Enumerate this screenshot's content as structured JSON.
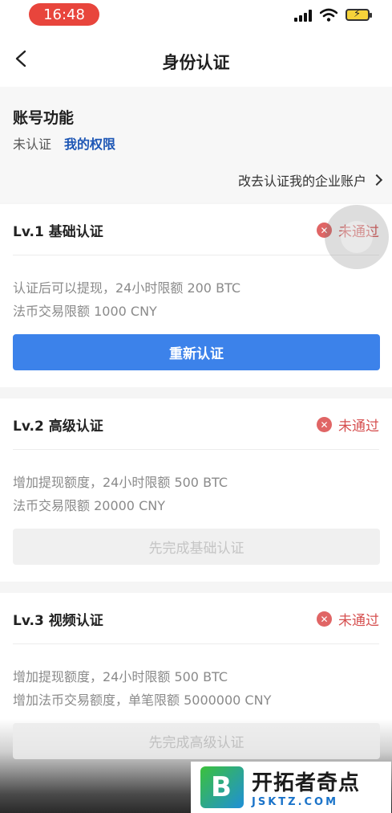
{
  "status_bar": {
    "time": "16:48"
  },
  "nav": {
    "title": "身份认证"
  },
  "account": {
    "title": "账号功能",
    "status": "未认证",
    "permissions_link": "我的权限",
    "enterprise_link": "改去认证我的企业账户"
  },
  "levels": [
    {
      "title": "Lv.1 基础认证",
      "status": "未通过",
      "desc_line1": "认证后可以提现，24小时限额 200 BTC",
      "desc_line2": "法币交易限额 1000 CNY",
      "button": "重新认证"
    },
    {
      "title": "Lv.2 高级认证",
      "status": "未通过",
      "desc_line1": "增加提现额度，24小时限额 500 BTC",
      "desc_line2": "法币交易限额 20000 CNY",
      "button": "先完成基础认证"
    },
    {
      "title": "Lv.3 视频认证",
      "status": "未通过",
      "desc_line1": "增加提现额度，24小时限额 500 BTC",
      "desc_line2": "增加法币交易额度，单笔限额 5000000 CNY",
      "button": "先完成高级认证"
    }
  ],
  "watermark": {
    "name": "开拓者奇点",
    "url": "JSKTZ.COM"
  },
  "colors": {
    "primary": "#3c82ea",
    "fail": "#d65050",
    "link": "#1d56b5",
    "time_pill": "#e8453c"
  }
}
